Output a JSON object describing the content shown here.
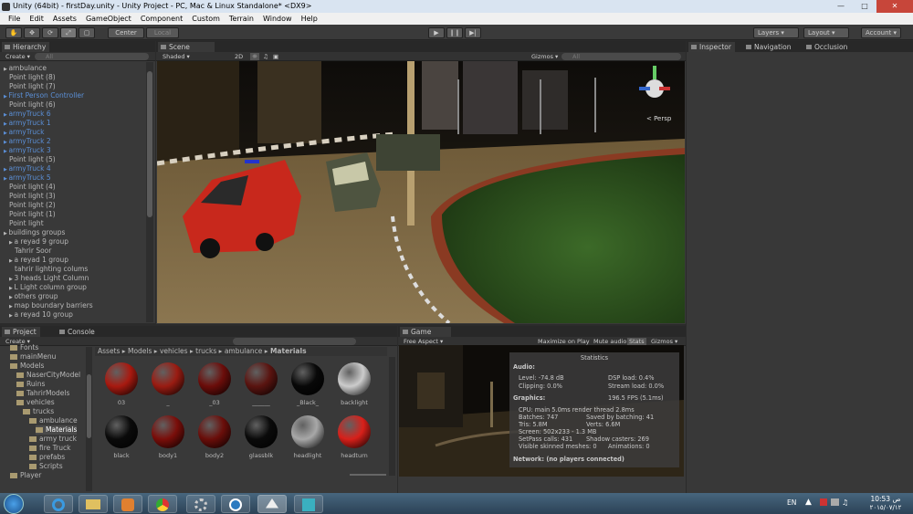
{
  "window": {
    "title": "Unity (64bit) - firstDay.unity - Unity Project - PC, Mac & Linux Standalone* <DX9>"
  },
  "menu": [
    "File",
    "Edit",
    "Assets",
    "GameObject",
    "Component",
    "Custom",
    "Terrain",
    "Window",
    "Help"
  ],
  "toolbar": {
    "pivot": "Center",
    "space": "Local",
    "layers": "Layers",
    "layout": "Layout",
    "account": "Account"
  },
  "hierarchy": {
    "tab": "Hierarchy",
    "create": "Create",
    "search": "All",
    "items": [
      {
        "label": "ambulance",
        "blue": false,
        "indent": 0,
        "arrow": true
      },
      {
        "label": "Point light (8)",
        "blue": false,
        "indent": 1,
        "arrow": false
      },
      {
        "label": "Point light (7)",
        "blue": false,
        "indent": 1,
        "arrow": false
      },
      {
        "label": "First Person Controller",
        "blue": true,
        "indent": 0,
        "arrow": true
      },
      {
        "label": "Point light (6)",
        "blue": false,
        "indent": 1,
        "arrow": false
      },
      {
        "label": "armyTruck 6",
        "blue": true,
        "indent": 0,
        "arrow": true
      },
      {
        "label": "armyTruck 1",
        "blue": true,
        "indent": 0,
        "arrow": true
      },
      {
        "label": "armyTruck",
        "blue": true,
        "indent": 0,
        "arrow": true
      },
      {
        "label": "armyTruck 2",
        "blue": true,
        "indent": 0,
        "arrow": true
      },
      {
        "label": "armyTruck 3",
        "blue": true,
        "indent": 0,
        "arrow": true
      },
      {
        "label": "Point light (5)",
        "blue": false,
        "indent": 1,
        "arrow": false
      },
      {
        "label": "armyTruck 4",
        "blue": true,
        "indent": 0,
        "arrow": true
      },
      {
        "label": "armyTruck 5",
        "blue": true,
        "indent": 0,
        "arrow": true
      },
      {
        "label": "Point light (4)",
        "blue": false,
        "indent": 1,
        "arrow": false
      },
      {
        "label": "Point light (3)",
        "blue": false,
        "indent": 1,
        "arrow": false
      },
      {
        "label": "Point light (2)",
        "blue": false,
        "indent": 1,
        "arrow": false
      },
      {
        "label": "Point light (1)",
        "blue": false,
        "indent": 1,
        "arrow": false
      },
      {
        "label": "Point light",
        "blue": false,
        "indent": 1,
        "arrow": false
      },
      {
        "label": "buildings groups",
        "blue": false,
        "indent": 0,
        "arrow": true
      },
      {
        "label": "a reyad 9 group",
        "blue": false,
        "indent": 1,
        "arrow": true
      },
      {
        "label": "Tahrir Soor",
        "blue": false,
        "indent": 2,
        "arrow": false
      },
      {
        "label": "a reyad 1 group",
        "blue": false,
        "indent": 1,
        "arrow": true
      },
      {
        "label": "tahrir lighting colums",
        "blue": false,
        "indent": 2,
        "arrow": false
      },
      {
        "label": "3 heads Light Column",
        "blue": false,
        "indent": 1,
        "arrow": true
      },
      {
        "label": "L Light column group",
        "blue": false,
        "indent": 1,
        "arrow": true
      },
      {
        "label": "others group",
        "blue": false,
        "indent": 1,
        "arrow": true
      },
      {
        "label": "map boundary barriers",
        "blue": false,
        "indent": 1,
        "arrow": true
      },
      {
        "label": "a reyad 10 group",
        "blue": false,
        "indent": 1,
        "arrow": true
      }
    ]
  },
  "scene": {
    "tab": "Scene",
    "shading": "Shaded",
    "mode2d": "2D",
    "gizmos": "Gizmos",
    "search": "All",
    "persp": "< Persp"
  },
  "inspector": {
    "tabs": [
      "Inspector",
      "Navigation",
      "Occlusion"
    ]
  },
  "project": {
    "tabs": [
      "Project",
      "Console"
    ],
    "create": "Create",
    "tree": [
      {
        "label": "Fonts",
        "indent": 1
      },
      {
        "label": "mainMenu",
        "indent": 1
      },
      {
        "label": "Models",
        "indent": 1
      },
      {
        "label": "NaserCityModel",
        "indent": 2
      },
      {
        "label": "Ruins",
        "indent": 2
      },
      {
        "label": "TahrirModels",
        "indent": 2
      },
      {
        "label": "vehicles",
        "indent": 2
      },
      {
        "label": "trucks",
        "indent": 3
      },
      {
        "label": "ambulance",
        "indent": 4
      },
      {
        "label": "Materials",
        "indent": 5
      },
      {
        "label": "army truck",
        "indent": 4
      },
      {
        "label": "fire Truck",
        "indent": 4
      },
      {
        "label": "prefabs",
        "indent": 4
      },
      {
        "label": "Scripts",
        "indent": 4
      },
      {
        "label": "Player",
        "indent": 1
      }
    ],
    "breadcrumb": [
      "Assets",
      "Models",
      "vehicles",
      "trucks",
      "ambulance",
      "Materials"
    ],
    "materials": [
      {
        "label": "03",
        "color": "#a81a10"
      },
      {
        "label": "_",
        "color": "#9a1c12"
      },
      {
        "label": "_03",
        "color": "#6b0d0a"
      },
      {
        "label": "______",
        "color": "#5a1410"
      },
      {
        "label": "_Black_",
        "color": "#080808"
      },
      {
        "label": "backlight",
        "color": "#cccccc"
      },
      {
        "label": "black",
        "color": "#0a0a0a"
      },
      {
        "label": "body1",
        "color": "#7a0e0a"
      },
      {
        "label": "body2",
        "color": "#6a0e0a"
      },
      {
        "label": "glassblk",
        "color": "#0a0a0a"
      },
      {
        "label": "headlight",
        "color": "#a8a8a8"
      },
      {
        "label": "headturn",
        "color": "#d8201a"
      }
    ]
  },
  "game": {
    "tab": "Game",
    "aspect": "Free Aspect",
    "buttons": [
      "Maximize on Play",
      "Mute audio",
      "Stats",
      "Gizmos"
    ],
    "stats": {
      "title": "Statistics",
      "audio_h": "Audio:",
      "level": "Level: -74.8 dB",
      "clipping": "Clipping: 0.0%",
      "dsp": "DSP load: 0.4%",
      "stream": "Stream load: 0.0%",
      "graphics_h": "Graphics:",
      "fps": "196.5 FPS (5.1ms)",
      "cpu": "CPU: main 5.0ms  render thread 2.8ms",
      "batches": "Batches: 747",
      "saved": "Saved by batching: 41",
      "tris": "Tris: 5.8M",
      "verts": "Verts: 6.6M",
      "screen": "Screen: 502x233 - 1.3 MB",
      "setpass": "SetPass calls: 431",
      "shadow": "Shadow casters: 269",
      "skinned": "Visible skinned meshes: 0",
      "anim": "Animations: 0",
      "network": "Network: (no players connected)"
    }
  },
  "taskbar": {
    "lang": "EN",
    "time": "10:53 ص",
    "date": "٢٠١٥/٠٧/١٢"
  }
}
